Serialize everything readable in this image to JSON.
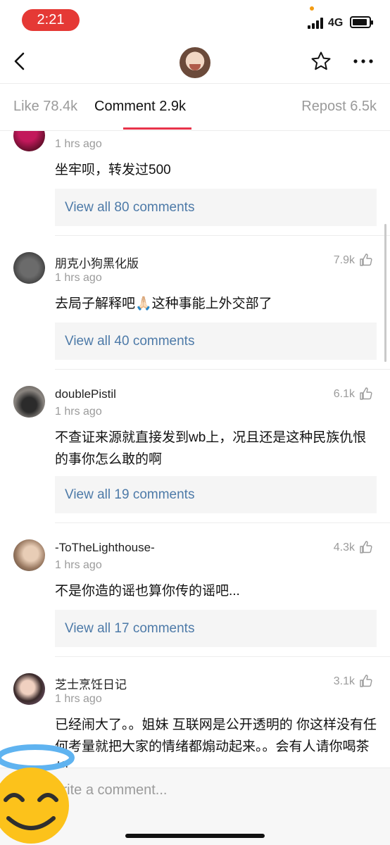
{
  "status": {
    "time": "2:21",
    "network": "4G"
  },
  "tabs": {
    "like": "Like 78.4k",
    "comment": "Comment 2.9k",
    "repost": "Repost 6.5k"
  },
  "comments": [
    {
      "name": "",
      "time": "1 hrs ago",
      "likes": "",
      "text": "坐牢呗，转发过500",
      "replies": "View all 80 comments"
    },
    {
      "name": "朋克小狗黑化版",
      "time": "1 hrs ago",
      "likes": "7.9k",
      "text": "去局子解释吧🙏🏻这种事能上外交部了",
      "replies": "View all 40 comments"
    },
    {
      "name": "doublePistil",
      "time": "1 hrs ago",
      "likes": "6.1k",
      "text": "不查证来源就直接发到wb上，况且还是这种民族仇恨的事你怎么敢的啊",
      "replies": "View all 19 comments"
    },
    {
      "name": "-ToTheLighthouse-",
      "time": "1 hrs ago",
      "likes": "4.3k",
      "text": "不是你造的谣也算你传的谣吧...",
      "replies": "View all 17 comments"
    },
    {
      "name": "芝士烹饪日记",
      "time": "1 hrs ago",
      "likes": "3.1k",
      "text": "已经闹大了。。姐妹 互联网是公开透明的 你这样没有任何考量就把大家的情绪都煽动起来。。会有人请你喝茶的",
      "replies": ""
    }
  ],
  "input": {
    "placeholder": "Write a comment..."
  },
  "colors": {
    "accent": "#e8334a",
    "link": "#4d7aa8",
    "status_pill": "#e53935"
  }
}
